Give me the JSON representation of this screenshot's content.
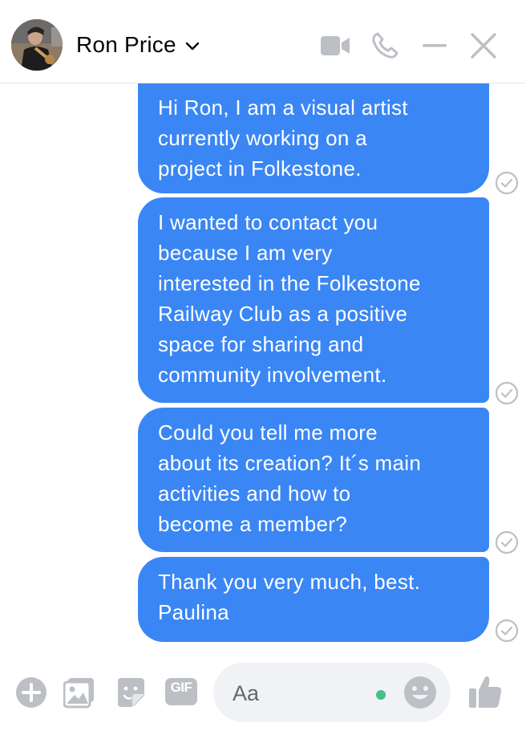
{
  "header": {
    "contact_name": "Ron Price",
    "icons": [
      "avatar-photo",
      "chevron-down-icon",
      "video-camera-icon",
      "phone-icon",
      "minimize-icon",
      "close-icon"
    ]
  },
  "messages": [
    {
      "text": "Hi Ron, I am a visual artist\ncurrently working on a\nproject in Folkestone.",
      "status": "sent"
    },
    {
      "text": "I wanted to contact you\nbecause I am very\ninterested in the Folkestone\nRailway Club as a positive\nspace for sharing and\ncommunity involvement.",
      "status": "sent"
    },
    {
      "text": "Could you tell me more\nabout its creation? It´s main\nactivities and how to\nbecome a member?",
      "status": "sent"
    },
    {
      "text": "Thank you very much, best.\nPaulina",
      "status": "sent"
    }
  ],
  "composer": {
    "placeholder": "Aa",
    "gif_label": "GIF",
    "icons": [
      "plus-icon",
      "photo-icon",
      "sticker-icon",
      "gif-icon",
      "emoji-icon",
      "thumbs-up-icon"
    ]
  },
  "colors": {
    "bubble": "#3a86f4",
    "icon_gray": "#bcc0c4",
    "online": "#44c08a"
  }
}
